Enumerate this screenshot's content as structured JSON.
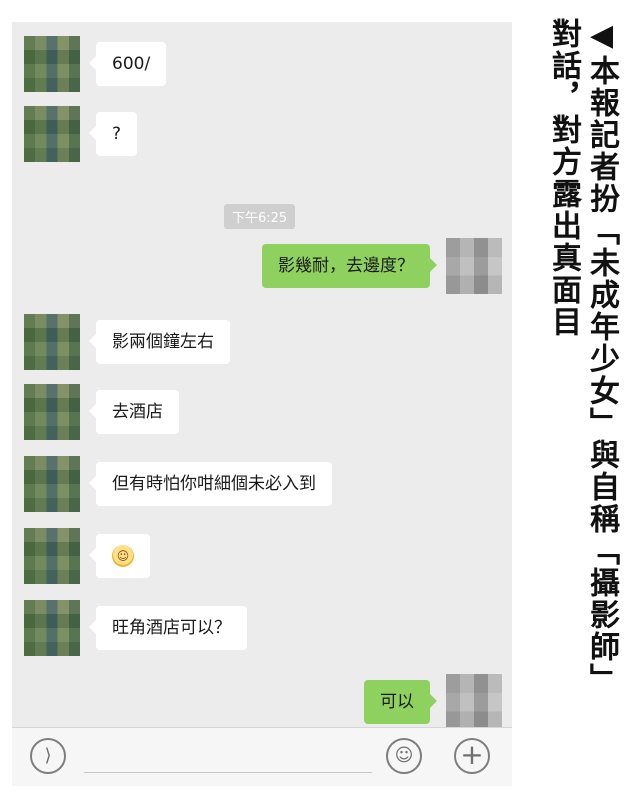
{
  "chat": {
    "messages": [
      {
        "side": "in",
        "text": "600/"
      },
      {
        "side": "in",
        "text": "?"
      },
      {
        "type": "time",
        "text": "下午6:25"
      },
      {
        "side": "out",
        "text": "影幾耐，去邊度？"
      },
      {
        "side": "in",
        "text": "影兩個鐘左右"
      },
      {
        "side": "in",
        "text": "去酒店"
      },
      {
        "side": "in",
        "text": "但有時怕你咁細個未必入到"
      },
      {
        "side": "in",
        "emoji": "sweat-smile-emoji"
      },
      {
        "side": "in",
        "text": "旺角酒店可以？"
      },
      {
        "side": "out",
        "text": "可以"
      }
    ]
  },
  "caption": {
    "col1": "◀本報記者扮「未成年少女」與自稱「攝影師」",
    "col2": "對話，對方露出真面目"
  },
  "icons": {
    "voice": "voice-icon",
    "emoji": "emoji-icon",
    "plus": "plus-icon"
  }
}
